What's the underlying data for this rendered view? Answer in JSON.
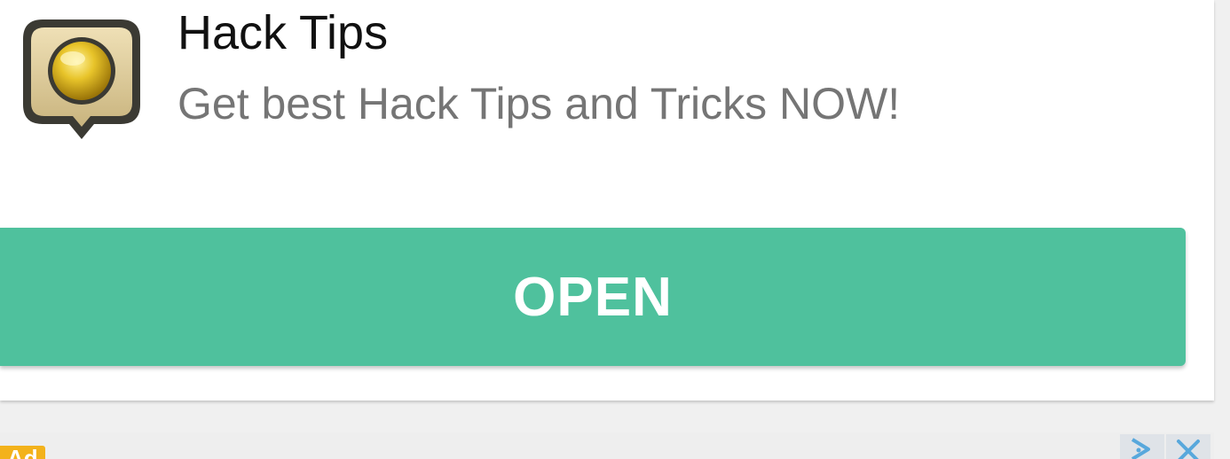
{
  "ad": {
    "title": "Hack Tips",
    "description": "Get best Hack Tips and Tricks NOW!",
    "cta_label": "OPEN",
    "badge": "Ad"
  },
  "icons": {
    "app_icon": "coin-pin-icon",
    "adchoices": "adchoices-icon",
    "close": "close-icon"
  },
  "colors": {
    "cta_background": "#4fc19d",
    "badge_background": "#f3b21b",
    "adchoices_blue": "#58a8dc"
  }
}
